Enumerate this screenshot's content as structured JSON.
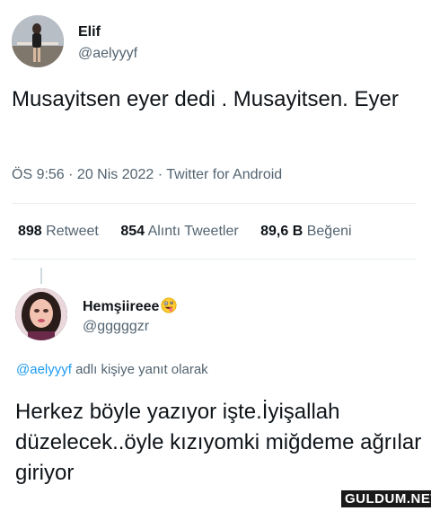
{
  "tweet": {
    "author_name": "Elif",
    "author_handle": "@aelyyyf",
    "text": "Musayitsen eyer dedi . Musayitsen. Eyer",
    "meta": "ÖS 9:56 · 20 Nis 2022 · Twitter for Android",
    "stats": {
      "retweets_count": "898",
      "retweets_label": "Retweet",
      "quotes_count": "854",
      "quotes_label": "Alıntı Tweetler",
      "likes_count": "89,6 B",
      "likes_label": "Beğeni"
    }
  },
  "reply": {
    "author_name": "Hemşiireee",
    "author_emoji": "zany-face-icon",
    "author_handle": "@gggggzr",
    "reply_to_handle": "@aelyyyf",
    "reply_to_suffix": " adlı kişiye yanıt olarak",
    "text": "Herkez böyle yazıyor işte.İyişallah düzelecek..öyle kızıyomki miğdeme ağrılar giriyor"
  },
  "watermark": "GULDUM.NET",
  "colors": {
    "text": "#0f1419",
    "secondary": "#536471",
    "link": "#1d9bf0",
    "divider": "#e6ecf0"
  }
}
